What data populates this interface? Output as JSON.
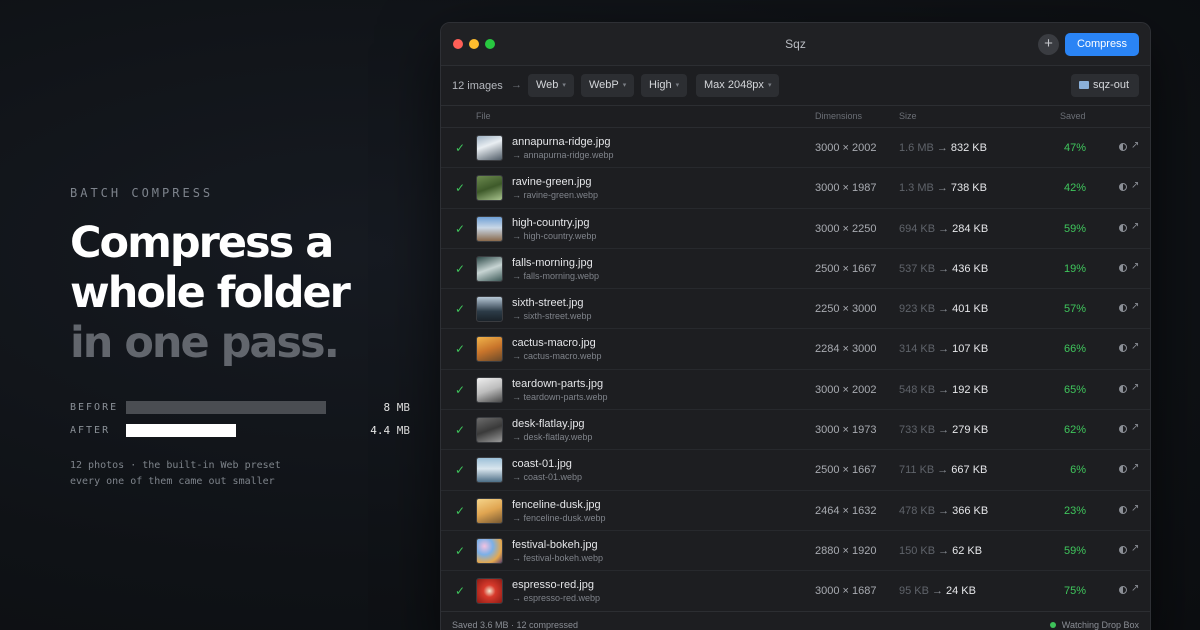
{
  "hero": {
    "eyebrow": "BATCH COMPRESS",
    "headline_line1": "Compress a",
    "headline_line2": "whole folder",
    "headline_line3": "in one pass.",
    "before_label": "BEFORE",
    "before_value": "8 MB",
    "before_fraction": 1.0,
    "after_label": "AFTER",
    "after_value": "4.4 MB",
    "after_fraction": 0.55,
    "caption_line1": "12 photos · the built-in Web preset",
    "caption_line2": "every one of them came out smaller"
  },
  "window": {
    "title": "Sqz",
    "plus_label": "+",
    "compress_label": "Compress"
  },
  "toolbar": {
    "count": "12 images",
    "arrow": "→",
    "preset": "Web",
    "format": "WebP",
    "quality": "High",
    "max_size": "Max 2048px",
    "output_folder": "sqz-out"
  },
  "table": {
    "headers": {
      "file": "File",
      "dimensions": "Dimensions",
      "size": "Size",
      "saved": "Saved"
    },
    "rows": [
      {
        "name": "annapurna-ridge.jpg",
        "output": "→ annapurna-ridge.webp",
        "dimensions": "3000 × 2002",
        "before": "1.6 MB",
        "after": "832 KB",
        "saved": "47%"
      },
      {
        "name": "ravine-green.jpg",
        "output": "→ ravine-green.webp",
        "dimensions": "3000 × 1987",
        "before": "1.3 MB",
        "after": "738 KB",
        "saved": "42%"
      },
      {
        "name": "high-country.jpg",
        "output": "→ high-country.webp",
        "dimensions": "3000 × 2250",
        "before": "694 KB",
        "after": "284 KB",
        "saved": "59%"
      },
      {
        "name": "falls-morning.jpg",
        "output": "→ falls-morning.webp",
        "dimensions": "2500 × 1667",
        "before": "537 KB",
        "after": "436 KB",
        "saved": "19%"
      },
      {
        "name": "sixth-street.jpg",
        "output": "→ sixth-street.webp",
        "dimensions": "2250 × 3000",
        "before": "923 KB",
        "after": "401 KB",
        "saved": "57%"
      },
      {
        "name": "cactus-macro.jpg",
        "output": "→ cactus-macro.webp",
        "dimensions": "2284 × 3000",
        "before": "314 KB",
        "after": "107 KB",
        "saved": "66%"
      },
      {
        "name": "teardown-parts.jpg",
        "output": "→ teardown-parts.webp",
        "dimensions": "3000 × 2002",
        "before": "548 KB",
        "after": "192 KB",
        "saved": "65%"
      },
      {
        "name": "desk-flatlay.jpg",
        "output": "→ desk-flatlay.webp",
        "dimensions": "3000 × 1973",
        "before": "733 KB",
        "after": "279 KB",
        "saved": "62%"
      },
      {
        "name": "coast-01.jpg",
        "output": "→ coast-01.webp",
        "dimensions": "2500 × 1667",
        "before": "711 KB",
        "after": "667 KB",
        "saved": "6%"
      },
      {
        "name": "fenceline-dusk.jpg",
        "output": "→ fenceline-dusk.webp",
        "dimensions": "2464 × 1632",
        "before": "478 KB",
        "after": "366 KB",
        "saved": "23%"
      },
      {
        "name": "festival-bokeh.jpg",
        "output": "→ festival-bokeh.webp",
        "dimensions": "2880 × 1920",
        "before": "150 KB",
        "after": "62 KB",
        "saved": "59%"
      },
      {
        "name": "espresso-red.jpg",
        "output": "→ espresso-red.webp",
        "dimensions": "3000 × 1687",
        "before": "95 KB",
        "after": "24 KB",
        "saved": "75%"
      }
    ]
  },
  "status": {
    "summary": "Saved 3.6 MB · 12 compressed",
    "watching": "Watching Drop Box"
  },
  "colors": {
    "accent": "#2a84f5",
    "saved_green": "#3fc65c",
    "traffic_red": "#ff5f57",
    "traffic_yellow": "#febc2e",
    "traffic_green": "#28c840"
  }
}
